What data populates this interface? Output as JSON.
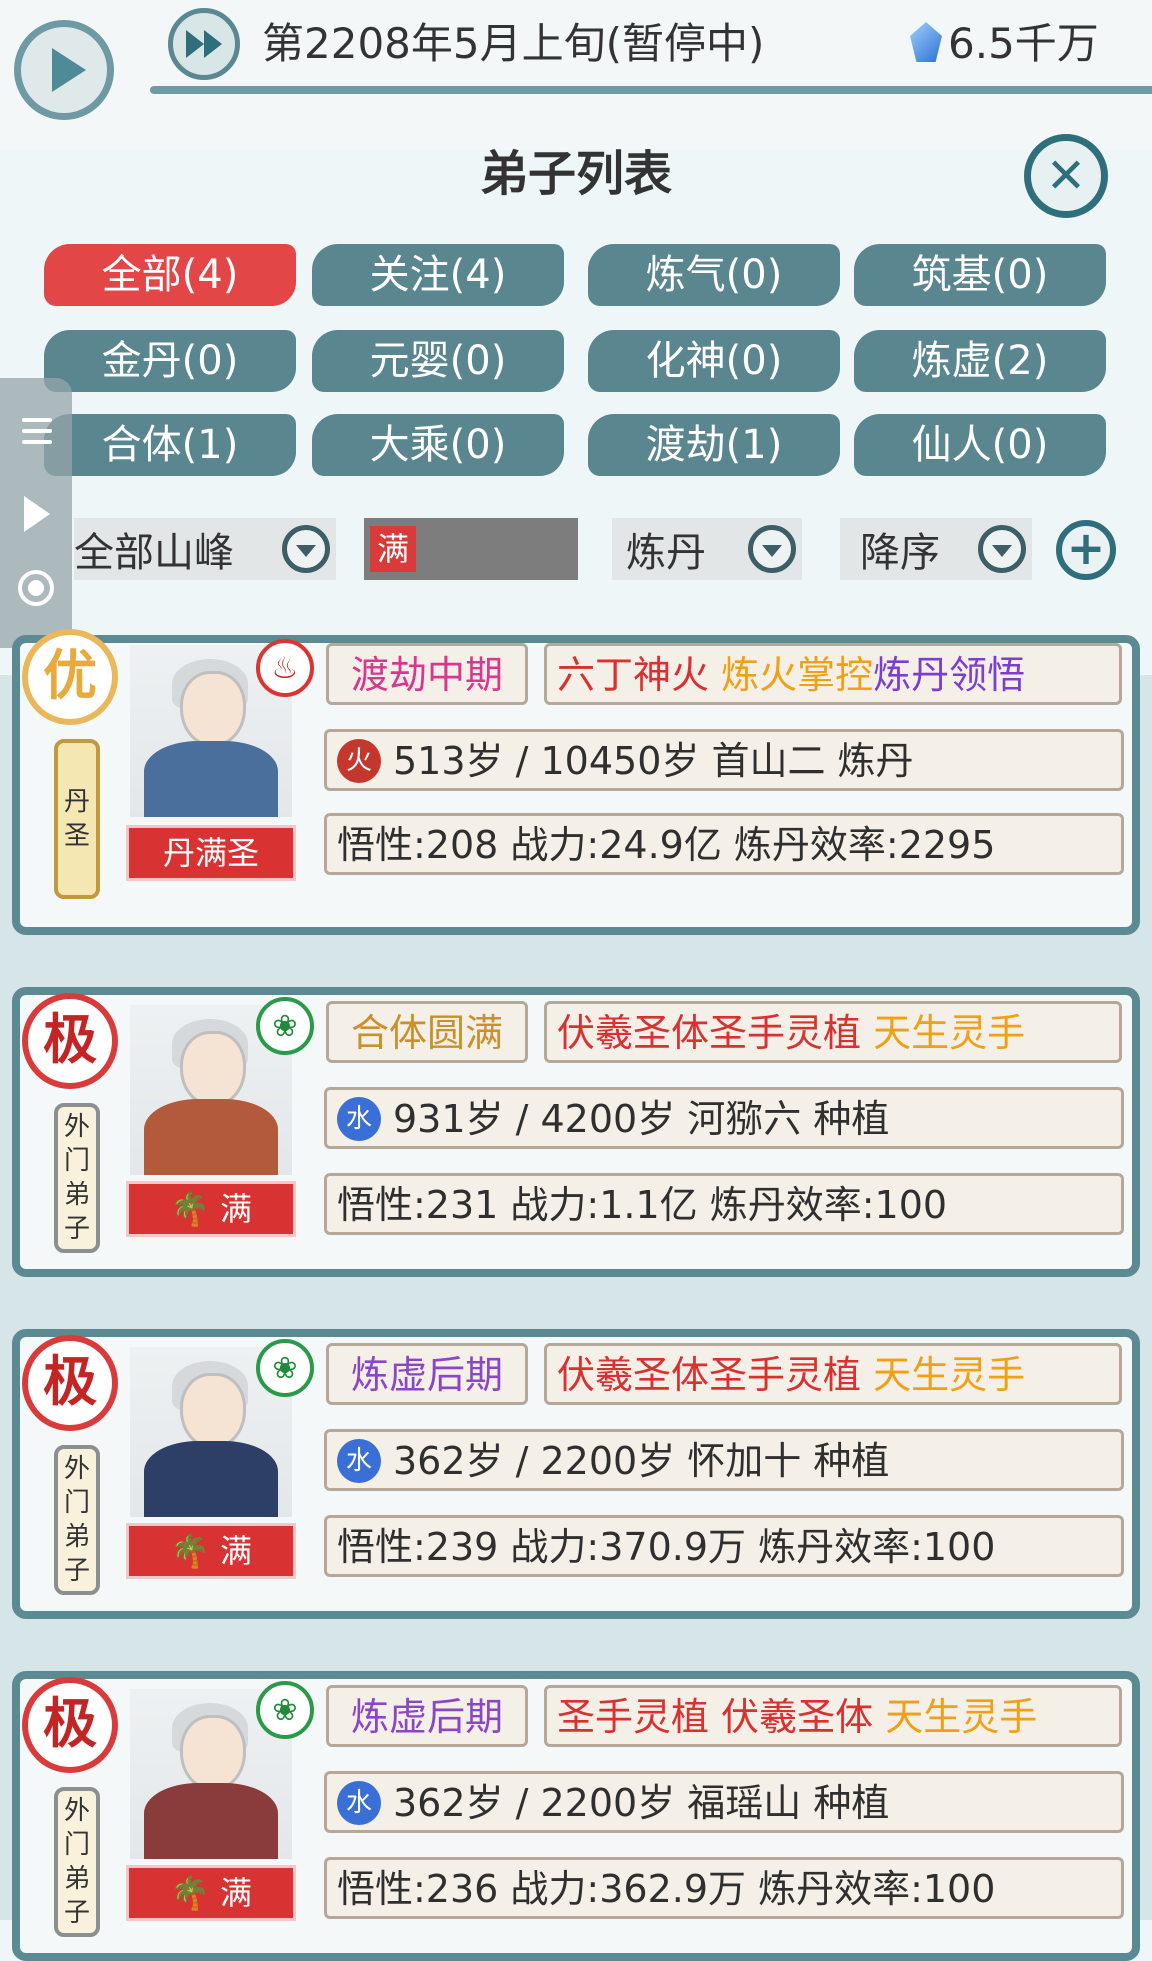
{
  "header": {
    "date": "第2208年5月上旬(暂停中)",
    "money": "6.5千万"
  },
  "panel": {
    "title": "弟子列表",
    "filters": [
      "全部(4)",
      "关注(4)",
      "炼气(0)",
      "筑基(0)",
      "金丹(0)",
      "元婴(0)",
      "化神(0)",
      "炼虚(2)",
      "合体(1)",
      "大乘(0)",
      "渡劫(1)",
      "仙人(0)"
    ],
    "active_filter": "全部(4)",
    "dropdown_mountain": "全部山峰",
    "full_tag": "满",
    "dropdown_skill": "炼丹",
    "dropdown_order": "降序"
  },
  "disciples": [
    {
      "grade": "优",
      "title": "丹圣",
      "name_plate": "丹满圣",
      "realm": "渡劫中期",
      "trait1": "六丁神火",
      "trait2": "炼火掌控",
      "trait3": "炼丹领悟",
      "element": "火",
      "info": "513岁 / 10450岁  首山二  炼丹",
      "stats": "悟性:208  战力:24.9亿  炼丹效率:2295"
    },
    {
      "grade": "极",
      "title": "外门弟子",
      "name_plate": "满",
      "realm": "合体圆满",
      "trait1": "伏羲圣体",
      "trait2": "圣手灵植",
      "trait3": "天生灵手",
      "element": "水",
      "info": "931岁 / 4200岁  河猕六  种植",
      "stats": "悟性:231  战力:1.1亿  炼丹效率:100"
    },
    {
      "grade": "极",
      "title": "外门弟子",
      "name_plate": "满",
      "realm": "炼虚后期",
      "trait1": "伏羲圣体",
      "trait2": "圣手灵植",
      "trait3": "天生灵手",
      "element": "水",
      "info": "362岁 / 2200岁  怀加十  种植",
      "stats": "悟性:239  战力:370.9万  炼丹效率:100"
    },
    {
      "grade": "极",
      "title": "外门弟子",
      "name_plate": "满",
      "realm": "炼虚后期",
      "trait1": "圣手灵植",
      "trait2": "伏羲圣体",
      "trait3": "天生灵手",
      "element": "水",
      "info": "362岁 / 2200岁  福瑶山  种植",
      "stats": "悟性:236  战力:362.9万  炼丹效率:100"
    }
  ]
}
